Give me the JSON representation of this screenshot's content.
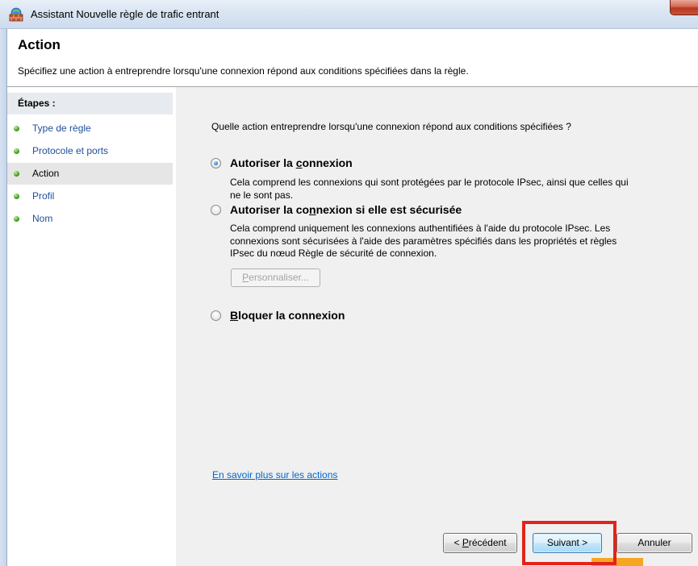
{
  "window": {
    "title": "Assistant Nouvelle règle de trafic entrant",
    "icon": "firewall-icon"
  },
  "header": {
    "title": "Action",
    "description": "Spécifiez une action à entreprendre lorsqu'une connexion répond aux conditions spécifiées dans la règle."
  },
  "steps": {
    "heading": "Étapes :",
    "bullet_icon": "green-bullet-icon",
    "items": [
      {
        "label": "Type de règle",
        "current": false
      },
      {
        "label": "Protocole et ports",
        "current": false
      },
      {
        "label": "Action",
        "current": true
      },
      {
        "label": "Profil",
        "current": false
      },
      {
        "label": "Nom",
        "current": false
      }
    ]
  },
  "main": {
    "question": "Quelle action entreprendre lorsqu'une connexion répond aux conditions spécifiées ?",
    "options": [
      {
        "label": {
          "before": "Autoriser la ",
          "key": "c",
          "after": "onnexion"
        },
        "selected": true,
        "description_lines": [
          "Cela comprend les connexions qui sont protégées par le protocole IPsec, ainsi que celles qui",
          "ne le sont pas."
        ]
      },
      {
        "label": {
          "before": "Autoriser la co",
          "key": "n",
          "after": "nexion si elle est sécurisée"
        },
        "selected": false,
        "description_lines": [
          "Cela comprend uniquement les connexions authentifiées à l'aide du protocole IPsec. Les",
          "connexions sont sécurisées à l'aide des paramètres spécifiés dans les propriétés et règles",
          "IPsec du nœud Règle de sécurité de connexion."
        ]
      },
      {
        "label": {
          "key": "B",
          "after": "loquer la connexion"
        },
        "selected": false
      }
    ],
    "customize_button": {
      "key": "P",
      "after": "ersonnaliser...",
      "enabled": false
    },
    "learn_more_link": "En savoir plus sur les actions"
  },
  "footer": {
    "back_button": {
      "before": "< ",
      "key": "P",
      "after": "récédent"
    },
    "next_button": "Suivant >",
    "cancel_button": "Annuler"
  },
  "colors": {
    "link": "#0066cc",
    "step_link": "#1e4f9a",
    "panel_bg": "#f0f0f0",
    "accent": "#3c7fb1",
    "step_bullet": "#3f9d1e",
    "highlight_box": "#e3231b",
    "overlay_bar": "#f5a623"
  }
}
